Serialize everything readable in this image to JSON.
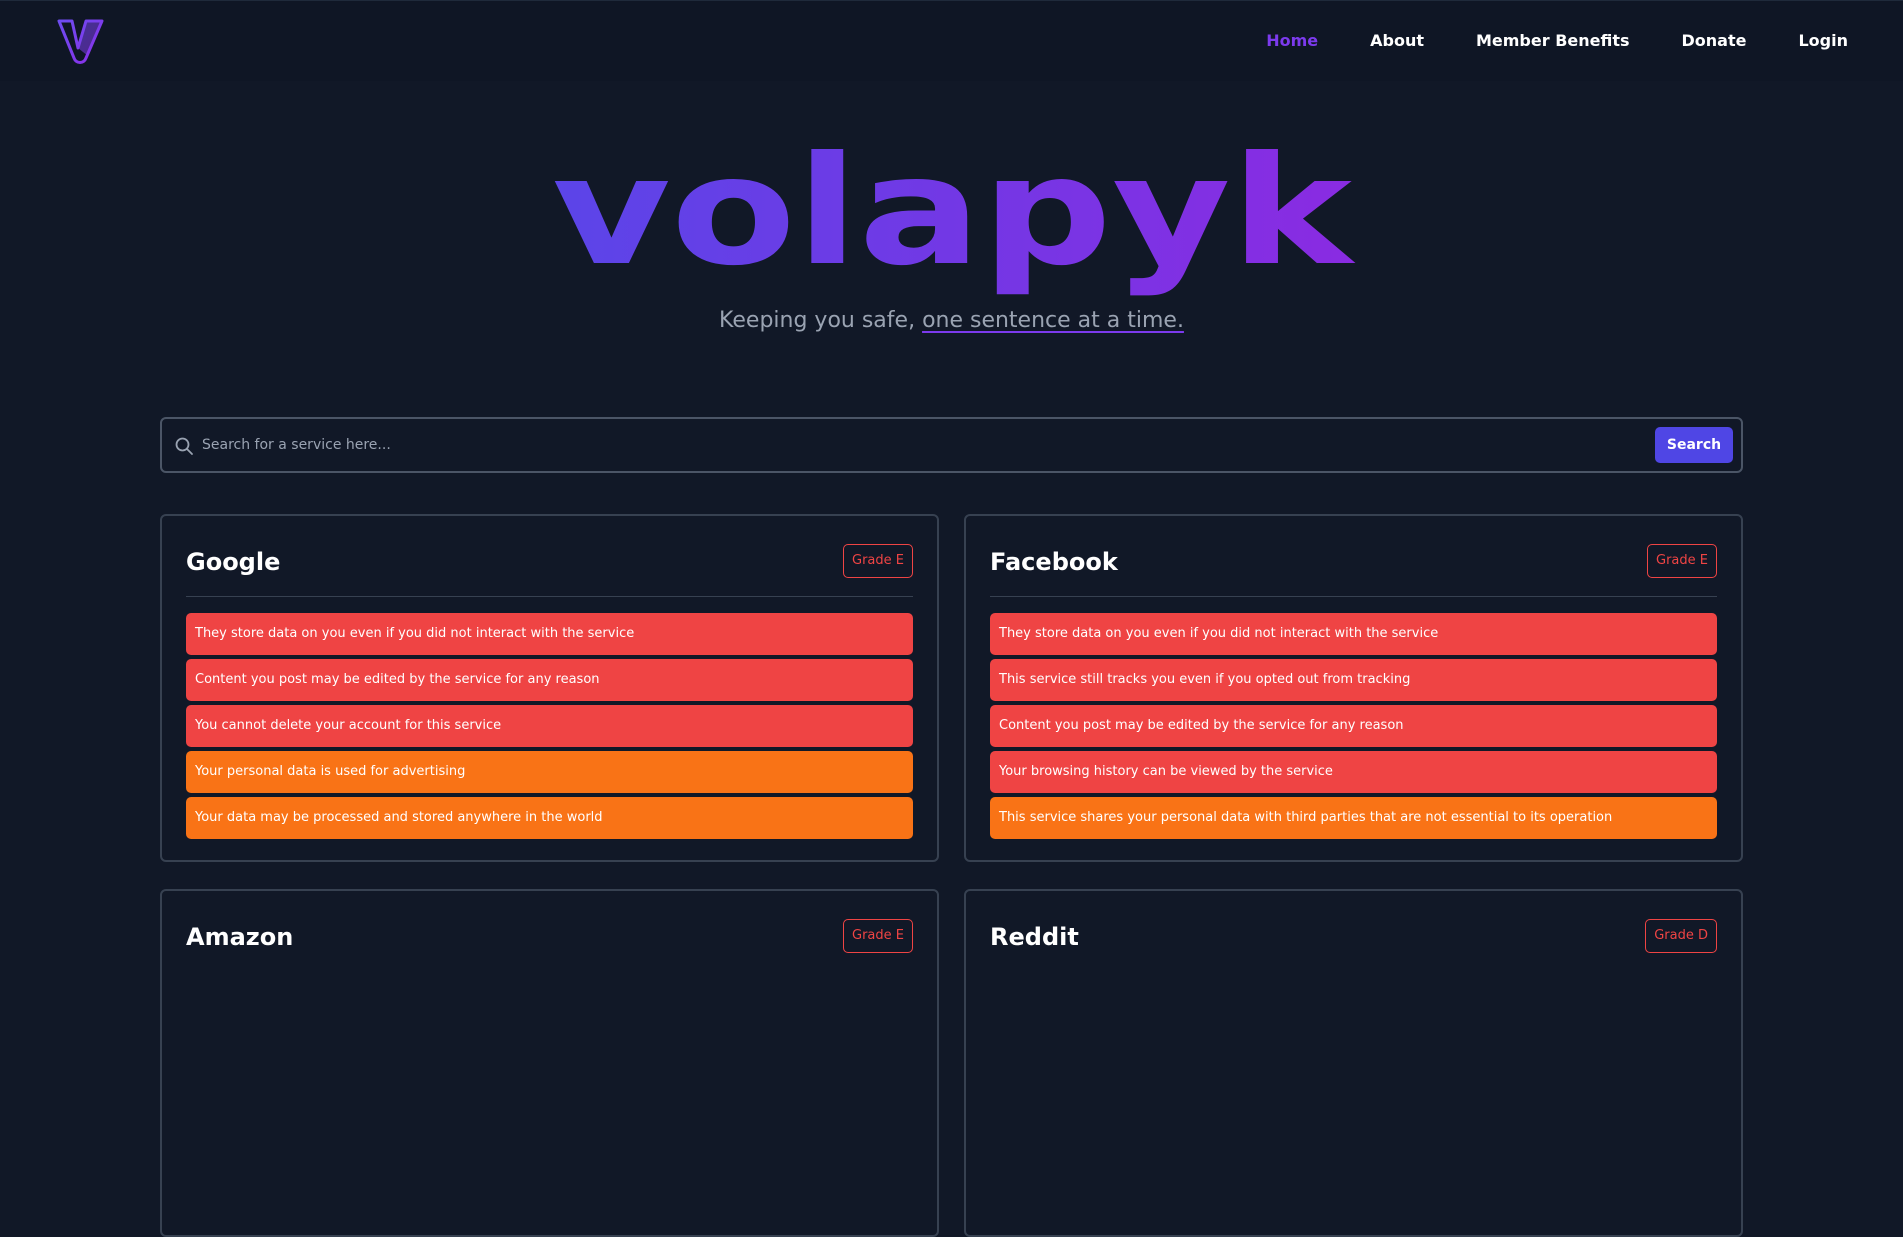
{
  "nav": {
    "logo_alt": "volapyk logo",
    "links": [
      {
        "label": "Home",
        "active": true
      },
      {
        "label": "About",
        "active": false
      },
      {
        "label": "Member Benefits",
        "active": false
      },
      {
        "label": "Donate",
        "active": false
      },
      {
        "label": "Login",
        "active": false
      }
    ]
  },
  "hero": {
    "wordmark": "volapyk",
    "tagline_prefix": "Keeping you safe, ",
    "tagline_link": "one sentence at a time."
  },
  "search": {
    "placeholder": "Search for a service here...",
    "button_label": "Search",
    "icon": "search-icon"
  },
  "colors": {
    "background": "#111827",
    "accent": "#7c3aed",
    "button": "#4f46e5",
    "bad": "#ef4444",
    "warning": "#f97316"
  },
  "services": [
    {
      "name": "Google",
      "grade": "Grade E",
      "points": [
        {
          "text": "They store data on you even if you did not interact with the service",
          "level": "red"
        },
        {
          "text": "Content you post may be edited by the service for any reason",
          "level": "red"
        },
        {
          "text": "You cannot delete your account for this service",
          "level": "red"
        },
        {
          "text": "Your personal data is used for advertising",
          "level": "orange"
        },
        {
          "text": "Your data may be processed and stored anywhere in the world",
          "level": "orange"
        }
      ]
    },
    {
      "name": "Facebook",
      "grade": "Grade E",
      "points": [
        {
          "text": "They store data on you even if you did not interact with the service",
          "level": "red"
        },
        {
          "text": "This service still tracks you even if you opted out from tracking",
          "level": "red"
        },
        {
          "text": "Content you post may be edited by the service for any reason",
          "level": "red"
        },
        {
          "text": "Your browsing history can be viewed by the service",
          "level": "red"
        },
        {
          "text": "This service shares your personal data with third parties that are not essential to its operation",
          "level": "orange"
        }
      ]
    },
    {
      "name": "Amazon",
      "grade": "Grade E",
      "points": []
    },
    {
      "name": "Reddit",
      "grade": "Grade D",
      "points": []
    }
  ]
}
